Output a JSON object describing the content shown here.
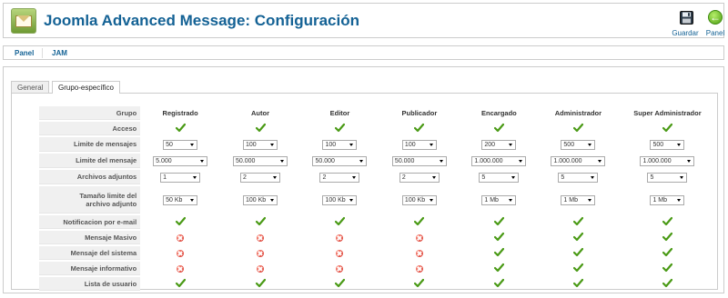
{
  "header": {
    "title": "Joomla Advanced Message: Configuración"
  },
  "toolbar": {
    "save_label": "Guardar",
    "panel_label": "Panel"
  },
  "subnav": {
    "items": [
      "Panel",
      "JAM"
    ]
  },
  "tabs": [
    "General",
    "Grupo-específico"
  ],
  "table": {
    "group_header": "Grupo",
    "columns": [
      "Registrado",
      "Autor",
      "Editor",
      "Publicador",
      "Encargado",
      "Administrador",
      "Super Administrador"
    ],
    "rows": {
      "acceso": {
        "label": "Acceso",
        "values": [
          "check",
          "check",
          "check",
          "check",
          "check",
          "check",
          "check"
        ]
      },
      "limite_mensajes": {
        "label": "Limite de mensajes",
        "values": [
          "50",
          "100",
          "100",
          "100",
          "200",
          "500",
          "500"
        ]
      },
      "limite_mensaje": {
        "label": "Limite del mensaje",
        "values": [
          "5.000",
          "50.000",
          "50.000",
          "50.000",
          "1.000.000",
          "1.000.000",
          "1.000.000"
        ]
      },
      "archivos": {
        "label": "Archivos adjuntos",
        "values": [
          "1",
          "2",
          "2",
          "2",
          "5",
          "5",
          "5"
        ]
      },
      "tamano": {
        "label_line1": "Tamaño limite del",
        "label_line2": "archivo adjunto",
        "values": [
          "50 Kb",
          "100 Kb",
          "100 Kb",
          "100 Kb",
          "1 Mb",
          "1 Mb",
          "1 Mb"
        ]
      },
      "notificacion": {
        "label": "Notificacion por e-mail",
        "values": [
          "check",
          "check",
          "check",
          "check",
          "check",
          "check",
          "check"
        ]
      },
      "masivo": {
        "label": "Mensaje Masivo",
        "values": [
          "cross",
          "cross",
          "cross",
          "cross",
          "check",
          "check",
          "check"
        ]
      },
      "sistema": {
        "label": "Mensaje del sistema",
        "values": [
          "cross",
          "cross",
          "cross",
          "cross",
          "check",
          "check",
          "check"
        ]
      },
      "informativo": {
        "label": "Mensaje informativo",
        "values": [
          "cross",
          "cross",
          "cross",
          "cross",
          "check",
          "check",
          "check"
        ]
      },
      "lista": {
        "label": "Lista de usuario",
        "values": [
          "check",
          "check",
          "check",
          "check",
          "check",
          "check",
          "check"
        ]
      }
    }
  },
  "colors": {
    "accent": "#146295",
    "check": "#4a9a16",
    "cross": "#d1241a"
  }
}
